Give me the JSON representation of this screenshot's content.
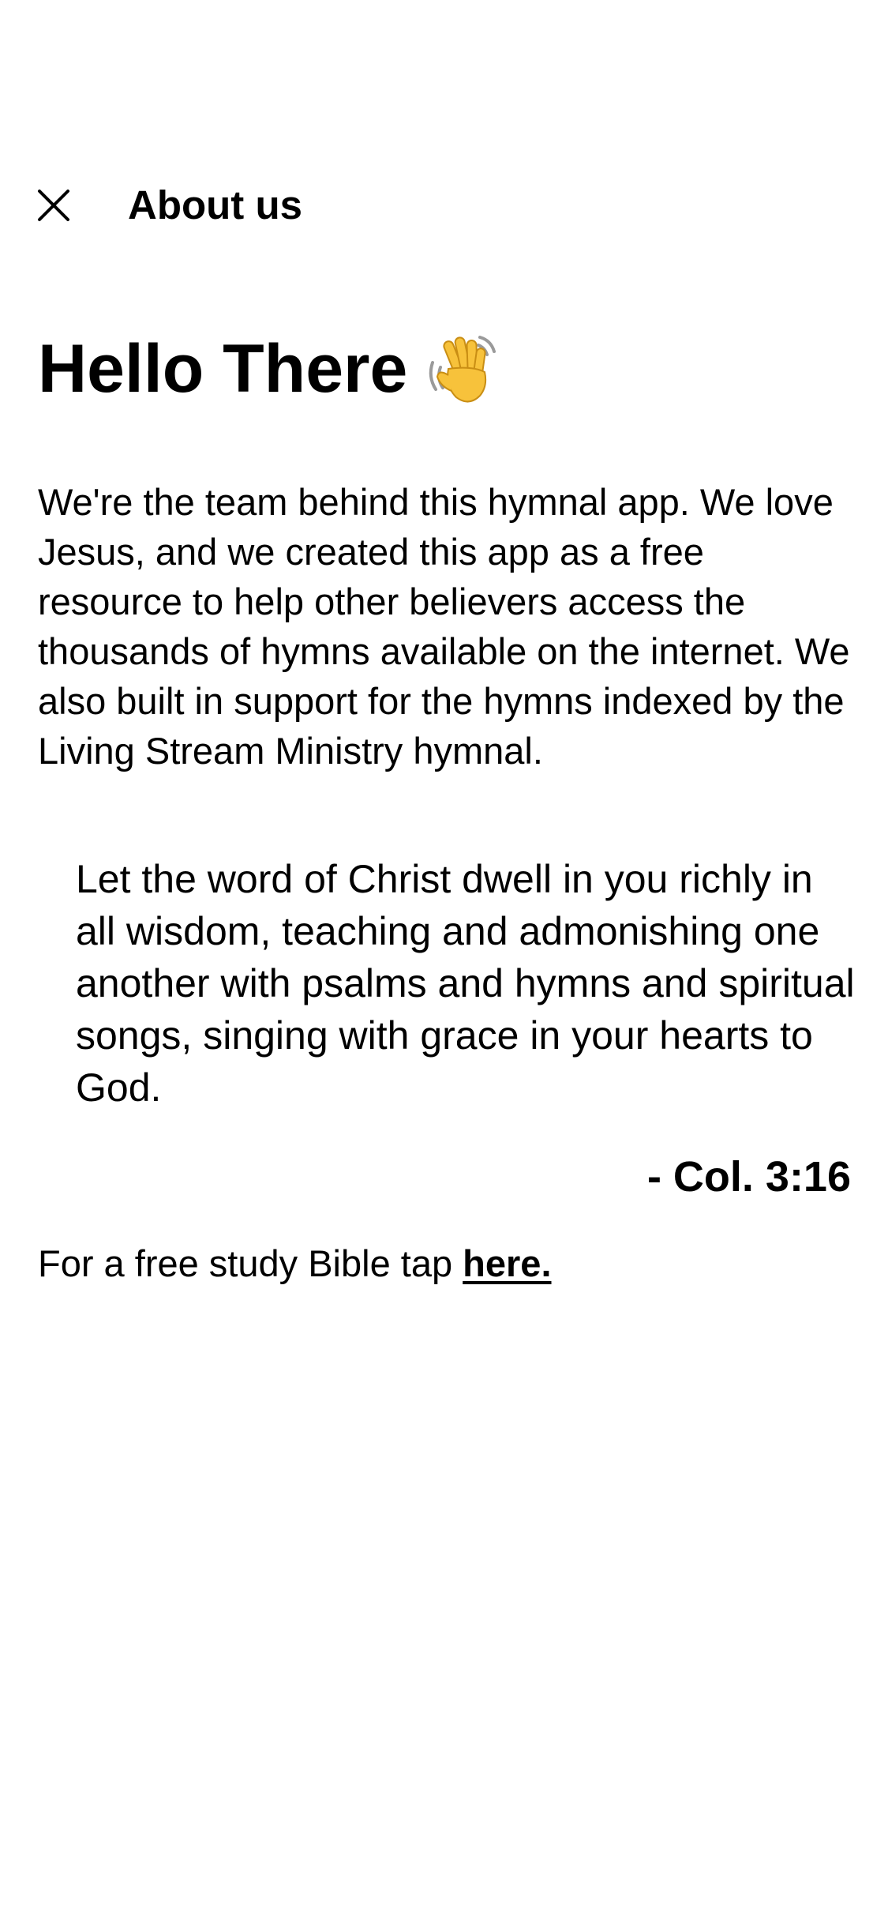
{
  "header": {
    "close_icon": "close-icon",
    "title": "About us"
  },
  "main": {
    "greeting": "Hello There",
    "greeting_icon": "waving-hand-icon",
    "intro": "We're the team behind this hymnal app. We love Jesus, and we created this app as a free resource to help other believers access the thousands of hymns available on the internet. We also built in support for the hymns indexed by the Living Stream Ministry hymnal.",
    "verse": "Let the word of Christ dwell in you richly in all wisdom, teaching and admonishing one another with psalms and hymns and spiritual songs, singing with grace in your hearts to God.",
    "verse_reference": "- Col. 3:16",
    "bible_prompt": "For a free study Bible tap",
    "bible_link": "here."
  },
  "colors": {
    "background": "#ffffff",
    "text": "#000000",
    "wave_hand": "#f7c23b"
  }
}
